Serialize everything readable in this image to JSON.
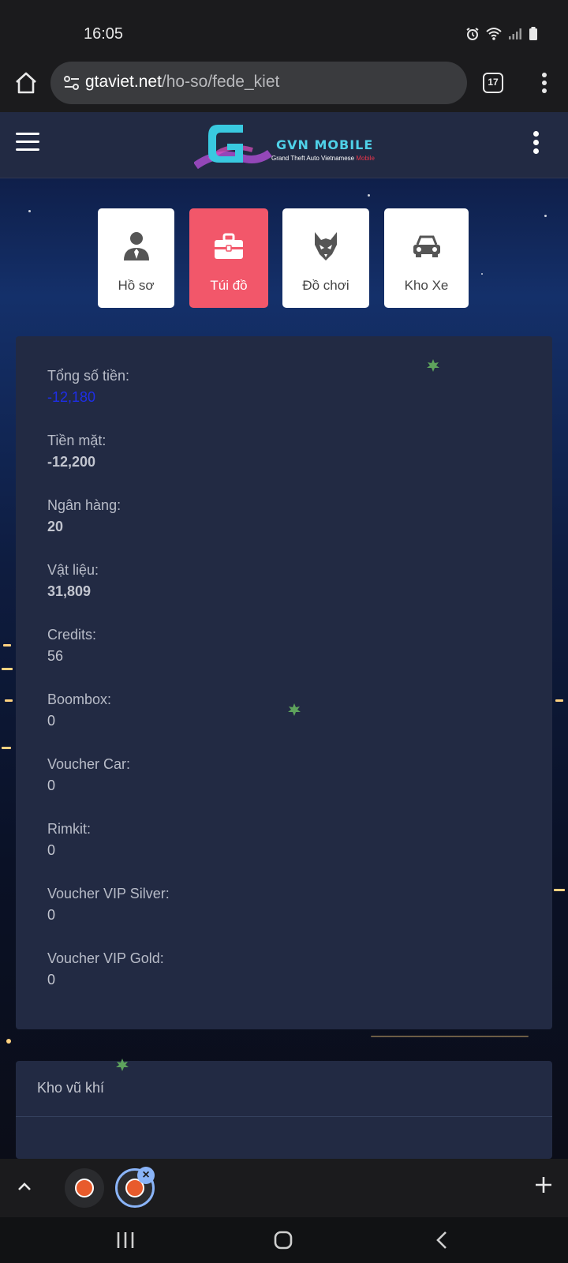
{
  "status_bar": {
    "time": "16:05"
  },
  "browser": {
    "url_domain": "gtaviet.net",
    "url_path": "/ho-so/fede_kiet",
    "tab_count": "17"
  },
  "site": {
    "logo_title": "GVN MOBILE",
    "logo_subtitle_white": "Grand Theft Auto Vietnamese",
    "logo_subtitle_red": "Mobile"
  },
  "tabs": [
    {
      "label": "Hồ sơ",
      "icon": "user-icon"
    },
    {
      "label": "Túi đồ",
      "icon": "briefcase-icon",
      "active": true
    },
    {
      "label": "Đồ chơi",
      "icon": "wolf-mask-icon"
    },
    {
      "label": "Kho Xe",
      "icon": "car-icon"
    }
  ],
  "inventory": {
    "items": [
      {
        "label": "Tổng số tiền:",
        "value": "-12,180"
      },
      {
        "label": "Tiền mặt:",
        "value": "-12,200"
      },
      {
        "label": "Ngân hàng:",
        "value": "20"
      },
      {
        "label": "Vật liệu:",
        "value": "31,809"
      },
      {
        "label": "Credits:",
        "value": "56"
      },
      {
        "label": "Boombox:",
        "value": "0"
      },
      {
        "label": "Voucher Car:",
        "value": "0"
      },
      {
        "label": "Rimkit:",
        "value": "0"
      },
      {
        "label": "Voucher VIP Silver:",
        "value": "0"
      },
      {
        "label": "Voucher VIP Gold:",
        "value": "0"
      }
    ]
  },
  "weapons": {
    "title": "Kho vũ khí"
  },
  "colors": {
    "active_tab": "#f2576a",
    "panel": "#222a43",
    "total_value": "#1e2ee8",
    "accent": "#8ab4f8"
  }
}
